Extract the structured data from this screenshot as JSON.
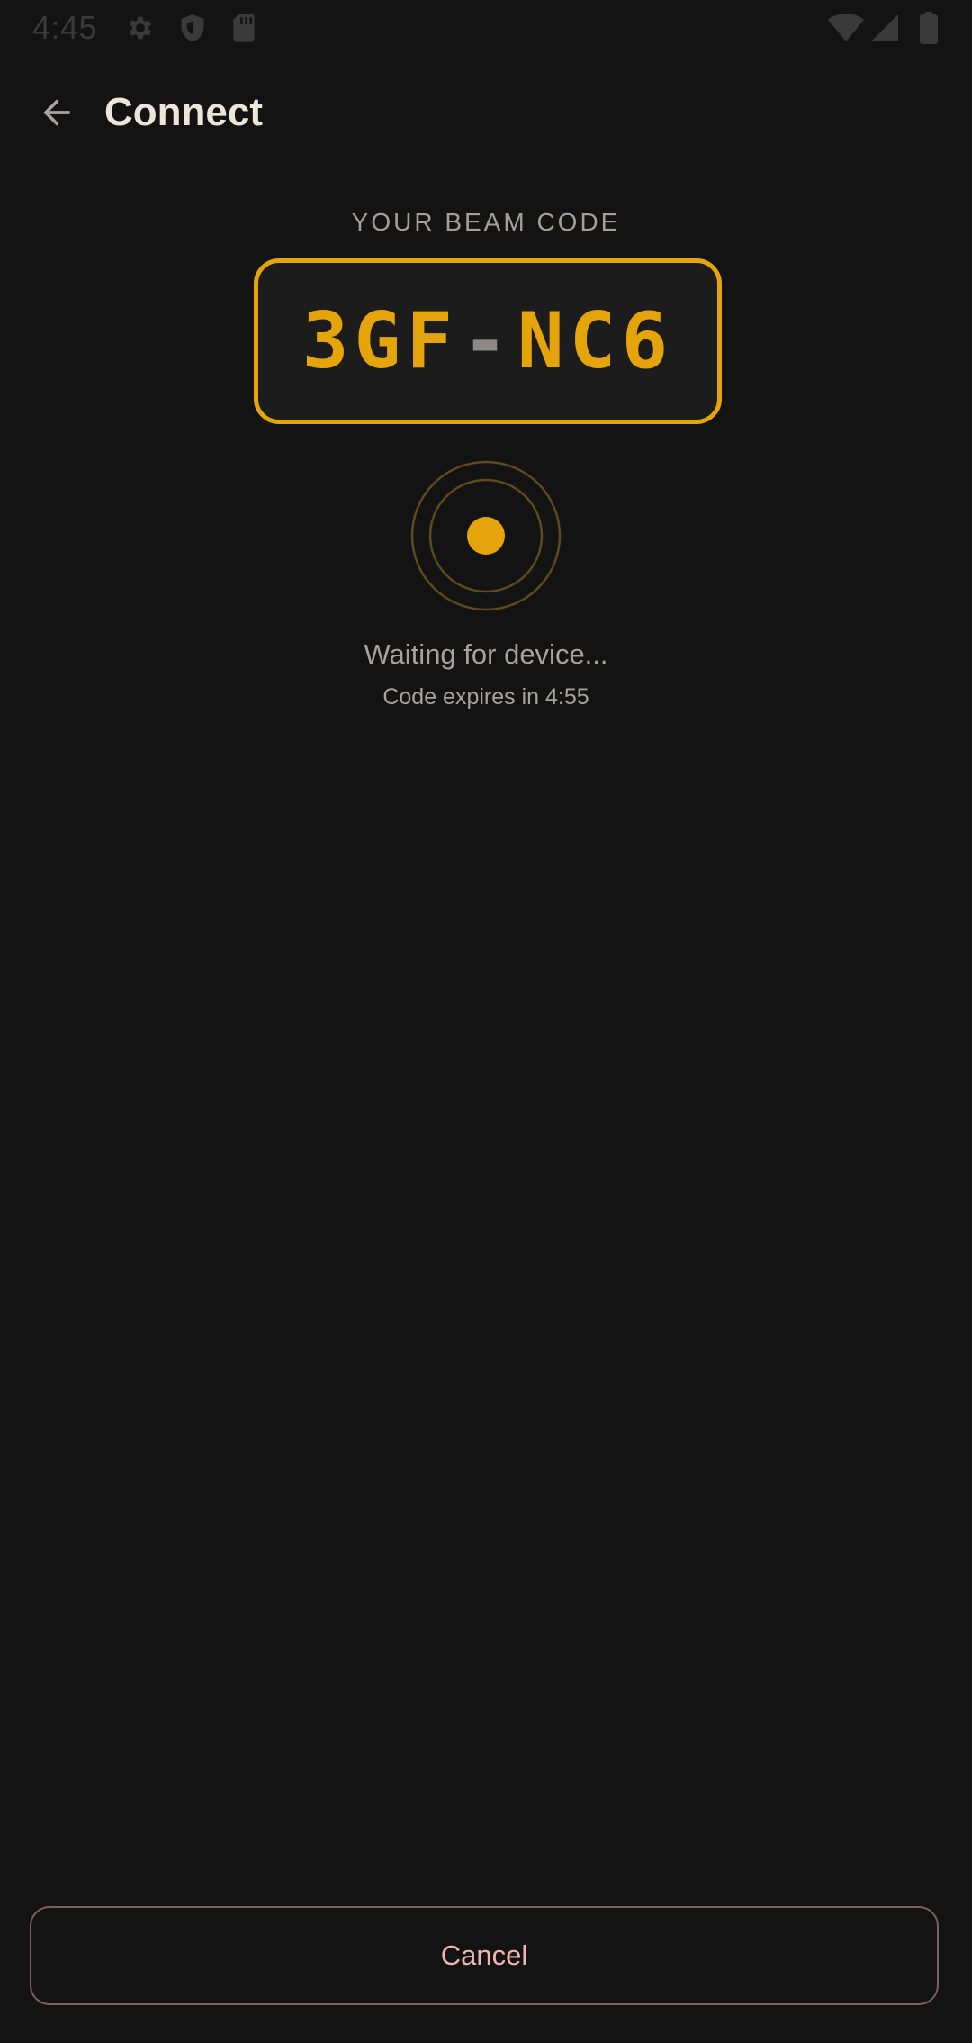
{
  "status_bar": {
    "time": "4:45",
    "icons": [
      "settings-gear-icon",
      "shield-icon",
      "sim-card-icon",
      "wifi-icon",
      "cellular-signal-icon",
      "battery-icon"
    ]
  },
  "app_bar": {
    "back_icon": "arrow-back-icon",
    "title": "Connect"
  },
  "beam": {
    "label": "YOUR BEAM CODE",
    "code_part1": "3GF",
    "code_separator": "-",
    "code_part2": "NC6"
  },
  "status": {
    "waiting": "Waiting for device...",
    "expires": "Code expires in 4:55"
  },
  "actions": {
    "cancel_label": "Cancel"
  },
  "colors": {
    "background": "#131313",
    "accent": "#e5a50a",
    "cancel_text": "#f2b4ae",
    "cancel_border": "#7e5f5a",
    "muted_text": "#a8a29a"
  }
}
